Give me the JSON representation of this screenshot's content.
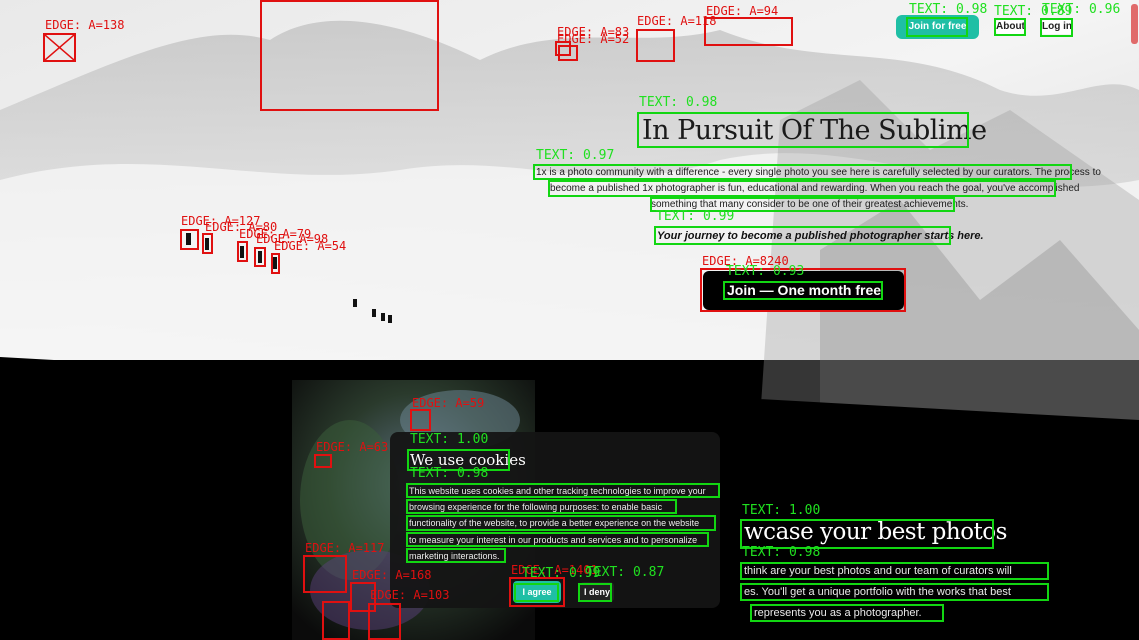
{
  "colors": {
    "accent": "#1fbfa5",
    "edge_box": "#e01010",
    "text_box": "#12d612",
    "cta_background": "#000000"
  },
  "nav": {
    "join_label": "Join for free",
    "about_label": "About",
    "login_label": "Log in",
    "join_score": "TEXT: 0.98",
    "about_score": "TEXT: 0.89",
    "login_score": "TEXT: 0.96"
  },
  "hero": {
    "title": "In Pursuit Of The Sublime",
    "title_score": "TEXT: 0.98",
    "para_score": "TEXT: 0.97",
    "para_lines": [
      "1x is a photo community with a difference - every single photo you see here is carefully selected by our curators. The process to",
      "become a published 1x photographer is fun, educational and rewarding. When you reach the goal, you've accomplished",
      "something that many consider to be one of their greatest achievements."
    ],
    "tagline": "Your journey to become a published photographer starts here.",
    "tagline_score": "TEXT: 0.99",
    "cta_label": "Join  —  One month free",
    "cta_score": "TEXT: 0.93"
  },
  "edge_labels": {
    "broken_image": "EDGE: A=138",
    "nav_a": "EDGE: A=83",
    "nav_b": "EDGE: A=52",
    "nav_c": "EDGE: A=118",
    "nav_d": "EDGE: A=94",
    "climber_1": "EDGE: A=127",
    "climber_2": "EDGE: A=80",
    "climber_3": "EDGE: A=79",
    "climber_4": "EDGE: A=98",
    "climber_5": "EDGE: A=54",
    "cta": "EDGE: A=8240",
    "cookie_icon": "EDGE: A=59",
    "gallery_icon": "EDGE: A=63",
    "gallery_a": "EDGE: A=117",
    "gallery_b": "EDGE: A=168",
    "gallery_c": "EDGE: A=103",
    "agree": "EDGE: A=1401"
  },
  "cookie": {
    "title": "We use cookies",
    "title_score": "TEXT: 1.00",
    "body_score": "TEXT: 0.98",
    "body_lines": [
      "This website uses cookies and other tracking technologies to improve your",
      "browsing experience for the following purposes: to enable basic",
      "functionality of the website, to provide a better experience on the website",
      "to measure your interest in our products and services and to personalize",
      "marketing interactions."
    ],
    "agree_label": "I agree",
    "agree_score": "TEXT: 0.99",
    "deny_label": "I deny",
    "deny_score": "TEXT: 0.87"
  },
  "showcase": {
    "title": "wcase your best photos",
    "title_score": "TEXT: 1.00",
    "body_score": "TEXT: 0.98",
    "body_lines": [
      "think are your best photos and our team of curators will",
      "es. You'll get a unique portfolio with the works that best",
      "represents you as a photographer."
    ]
  }
}
